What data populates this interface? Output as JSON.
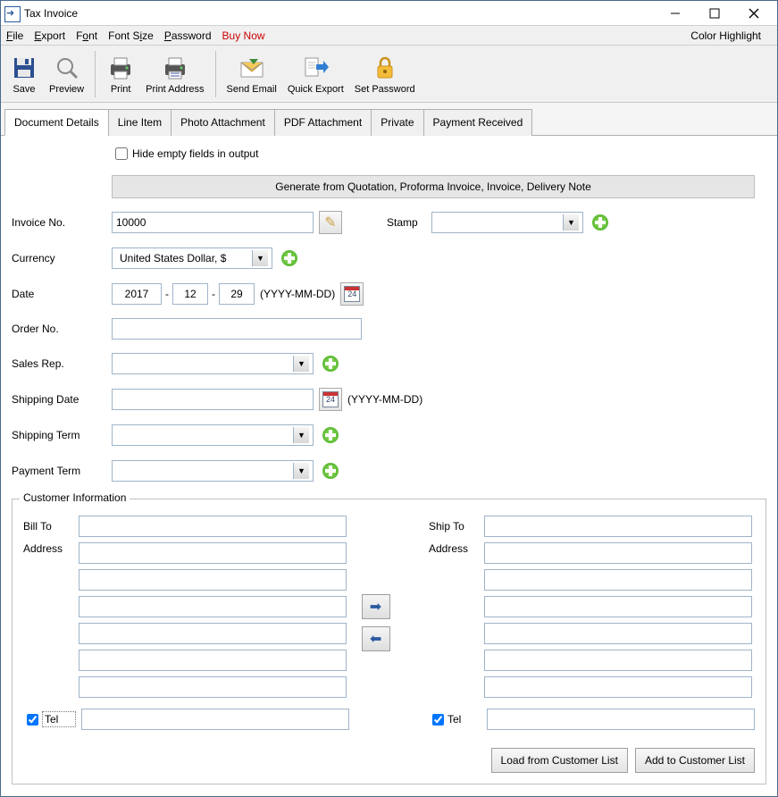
{
  "window": {
    "title": "Tax Invoice"
  },
  "menu": {
    "file": "File",
    "export": "Export",
    "font": "Font",
    "fontsize": "Font Size",
    "password": "Password",
    "buynow": "Buy Now",
    "color_highlight": "Color Highlight"
  },
  "toolbar": {
    "save": "Save",
    "preview": "Preview",
    "print": "Print",
    "print_address": "Print Address",
    "send_email": "Send Email",
    "quick_export": "Quick Export",
    "set_password": "Set Password"
  },
  "tabs": {
    "doc_details": "Document Details",
    "line_item": "Line Item",
    "photo_attachment": "Photo Attachment",
    "pdf_attachment": "PDF Attachment",
    "private": "Private",
    "payment_received": "Payment Received"
  },
  "form": {
    "hide_empty": "Hide empty fields in output",
    "generate_from": "Generate from Quotation, Proforma Invoice, Invoice, Delivery Note",
    "invoice_no_label": "Invoice No.",
    "invoice_no_value": "10000",
    "stamp_label": "Stamp",
    "stamp_value": "",
    "currency_label": "Currency",
    "currency_value": "United States Dollar, $",
    "date_label": "Date",
    "date_year": "2017",
    "date_month": "12",
    "date_day": "29",
    "date_format": "(YYYY-MM-DD)",
    "order_no_label": "Order No.",
    "order_no_value": "",
    "sales_rep_label": "Sales Rep.",
    "sales_rep_value": "",
    "shipping_date_label": "Shipping Date",
    "shipping_date_value": "",
    "shipping_date_format": "(YYYY-MM-DD)",
    "shipping_term_label": "Shipping Term",
    "shipping_term_value": "",
    "payment_term_label": "Payment Term",
    "payment_term_value": ""
  },
  "customer": {
    "legend": "Customer Information",
    "bill_to_label": "Bill To",
    "ship_to_label": "Ship To",
    "address_label": "Address",
    "tel_label": "Tel",
    "load_btn": "Load from Customer List",
    "add_btn": "Add to Customer List"
  },
  "calendar_num": "24"
}
